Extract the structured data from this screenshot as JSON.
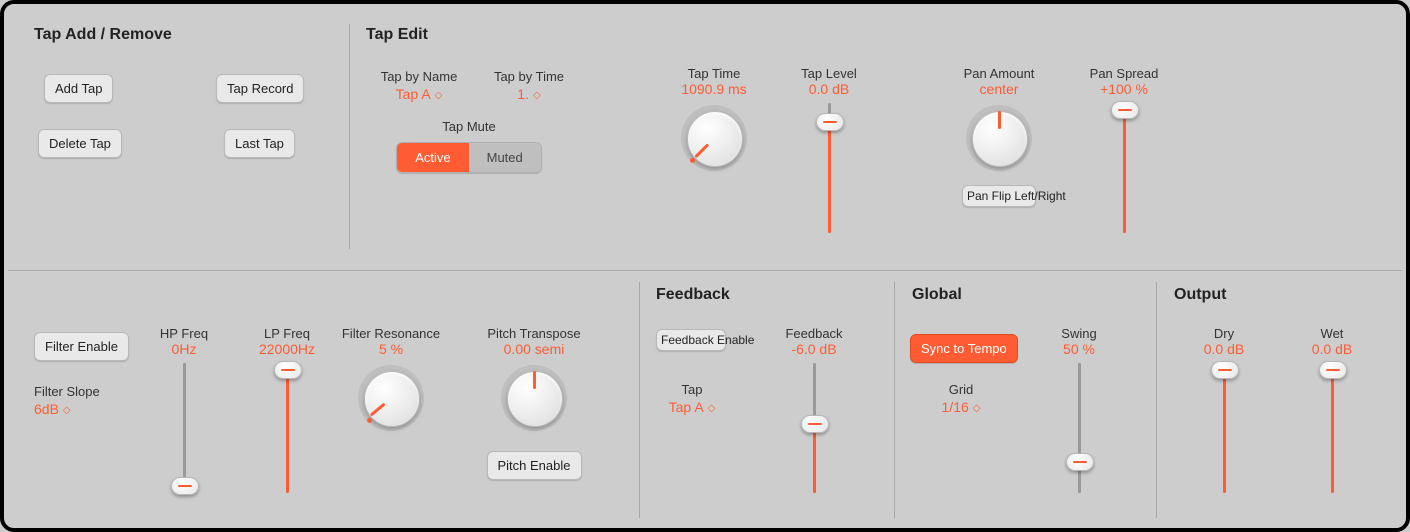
{
  "tap_add_remove": {
    "title": "Tap Add / Remove",
    "add_tap": "Add Tap",
    "tap_record": "Tap Record",
    "delete_tap": "Delete Tap",
    "last_tap": "Last Tap"
  },
  "tap_edit": {
    "title": "Tap Edit",
    "tap_by_name_label": "Tap by Name",
    "tap_by_name_value": "Tap A",
    "tap_by_time_label": "Tap by Time",
    "tap_by_time_value": "1.",
    "tap_mute_label": "Tap Mute",
    "tap_mute_active": "Active",
    "tap_mute_muted": "Muted",
    "tap_time_label": "Tap Time",
    "tap_time_value": "1090.9 ms",
    "tap_level_label": "Tap Level",
    "tap_level_value": "0.0 dB",
    "pan_amount_label": "Pan Amount",
    "pan_amount_value": "center",
    "pan_flip": "Pan Flip Left/Right",
    "pan_spread_label": "Pan Spread",
    "pan_spread_value": "+100 %"
  },
  "filter": {
    "filter_enable": "Filter Enable",
    "filter_slope_label": "Filter Slope",
    "filter_slope_value": "6dB",
    "hp_freq_label": "HP Freq",
    "hp_freq_value": "0Hz",
    "lp_freq_label": "LP Freq",
    "lp_freq_value": "22000Hz",
    "filter_res_label": "Filter Resonance",
    "filter_res_value": "5 %",
    "pitch_transpose_label": "Pitch Transpose",
    "pitch_transpose_value": "0.00 semi",
    "pitch_enable": "Pitch Enable"
  },
  "feedback": {
    "title": "Feedback",
    "enable": "Feedback Enable",
    "tap_label": "Tap",
    "tap_value": "Tap A",
    "feedback_label": "Feedback",
    "feedback_value": "-6.0 dB"
  },
  "global": {
    "title": "Global",
    "sync_to_tempo": "Sync to Tempo",
    "grid_label": "Grid",
    "grid_value": "1/16",
    "swing_label": "Swing",
    "swing_value": "50 %"
  },
  "output": {
    "title": "Output",
    "dry_label": "Dry",
    "dry_value": "0.0 dB",
    "wet_label": "Wet",
    "wet_value": "0.0 dB"
  },
  "chart_data": {
    "type": "table",
    "controls": [
      {
        "name": "Tap Time",
        "kind": "knob",
        "value": 1090.9,
        "unit": "ms",
        "pointer_angle_deg": -135
      },
      {
        "name": "Tap Level",
        "kind": "vslider",
        "value": 0.0,
        "unit": "dB",
        "thumb_pct_from_top": 12,
        "fill": "below"
      },
      {
        "name": "Pan Amount",
        "kind": "knob",
        "value": "center",
        "pointer_angle_deg": 0
      },
      {
        "name": "Pan Spread",
        "kind": "vslider",
        "value": 100,
        "unit": "%",
        "thumb_pct_from_top": 0,
        "fill": "below"
      },
      {
        "name": "HP Freq",
        "kind": "vslider",
        "value": 0,
        "unit": "Hz",
        "thumb_pct_from_top": 100,
        "fill": "none"
      },
      {
        "name": "LP Freq",
        "kind": "vslider",
        "value": 22000,
        "unit": "Hz",
        "thumb_pct_from_top": 0,
        "fill": "below"
      },
      {
        "name": "Filter Resonance",
        "kind": "knob",
        "value": 5,
        "unit": "%",
        "pointer_angle_deg": -135
      },
      {
        "name": "Pitch Transpose",
        "kind": "knob",
        "value": 0.0,
        "unit": "semi",
        "pointer_angle_deg": 0
      },
      {
        "name": "Feedback",
        "kind": "vslider",
        "value": -6.0,
        "unit": "dB",
        "thumb_pct_from_top": 45,
        "fill": "below"
      },
      {
        "name": "Swing",
        "kind": "vslider",
        "value": 50,
        "unit": "%",
        "thumb_pct_from_top": 70,
        "fill": "none"
      },
      {
        "name": "Dry",
        "kind": "vslider",
        "value": 0.0,
        "unit": "dB",
        "thumb_pct_from_top": 0,
        "fill": "below"
      },
      {
        "name": "Wet",
        "kind": "vslider",
        "value": 0.0,
        "unit": "dB",
        "thumb_pct_from_top": 0,
        "fill": "below"
      }
    ]
  }
}
